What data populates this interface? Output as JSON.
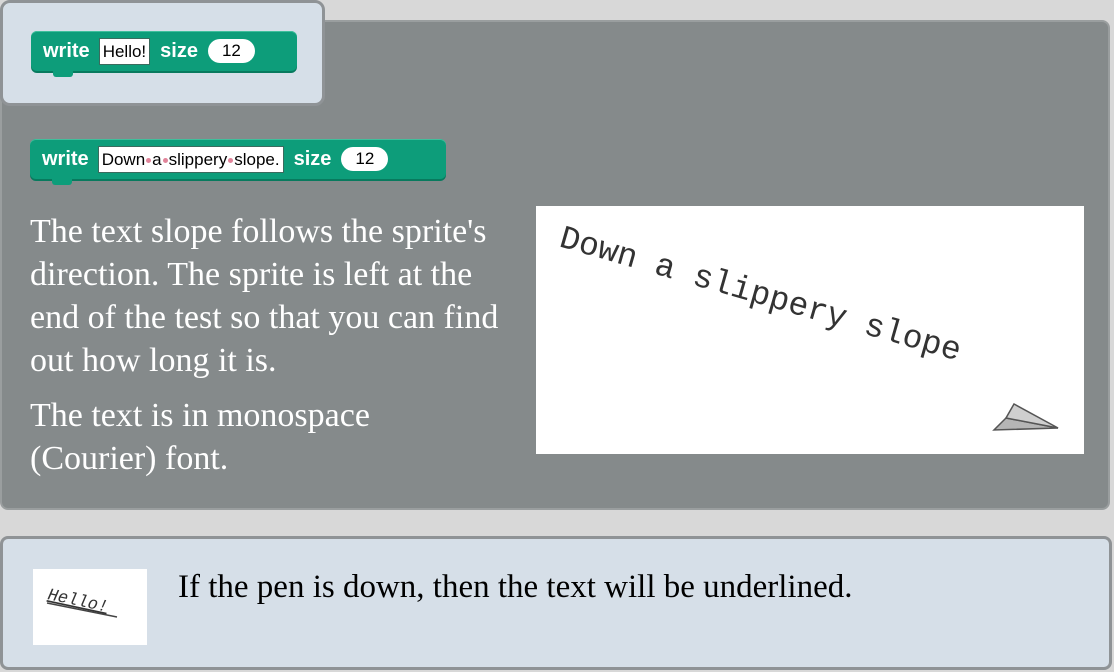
{
  "hint_block": {
    "keyword": "write",
    "text": "Hello!",
    "size_keyword": "size",
    "size_value": "12"
  },
  "main_block": {
    "keyword": "write",
    "text_words": [
      "Down",
      "a",
      "slippery",
      "slope."
    ],
    "size_keyword": "size",
    "size_value": "12"
  },
  "description": {
    "paragraph1": "The text slope follows the sprite's direction. The sprite is left at the end of the test so that you can find out how long it is.",
    "paragraph2": "The text is in monospace (Courier) font."
  },
  "preview": {
    "rendered_text": "Down a slippery slope",
    "icon": "arrow-sprite-icon"
  },
  "note": {
    "thumbnail_text": "Hello!",
    "text": "If the pen is down, then the text will be underlined."
  },
  "colors": {
    "block_green": "#0d9d7a",
    "panel_gray": "#858a8b",
    "card_blue": "#d6dfe8"
  }
}
